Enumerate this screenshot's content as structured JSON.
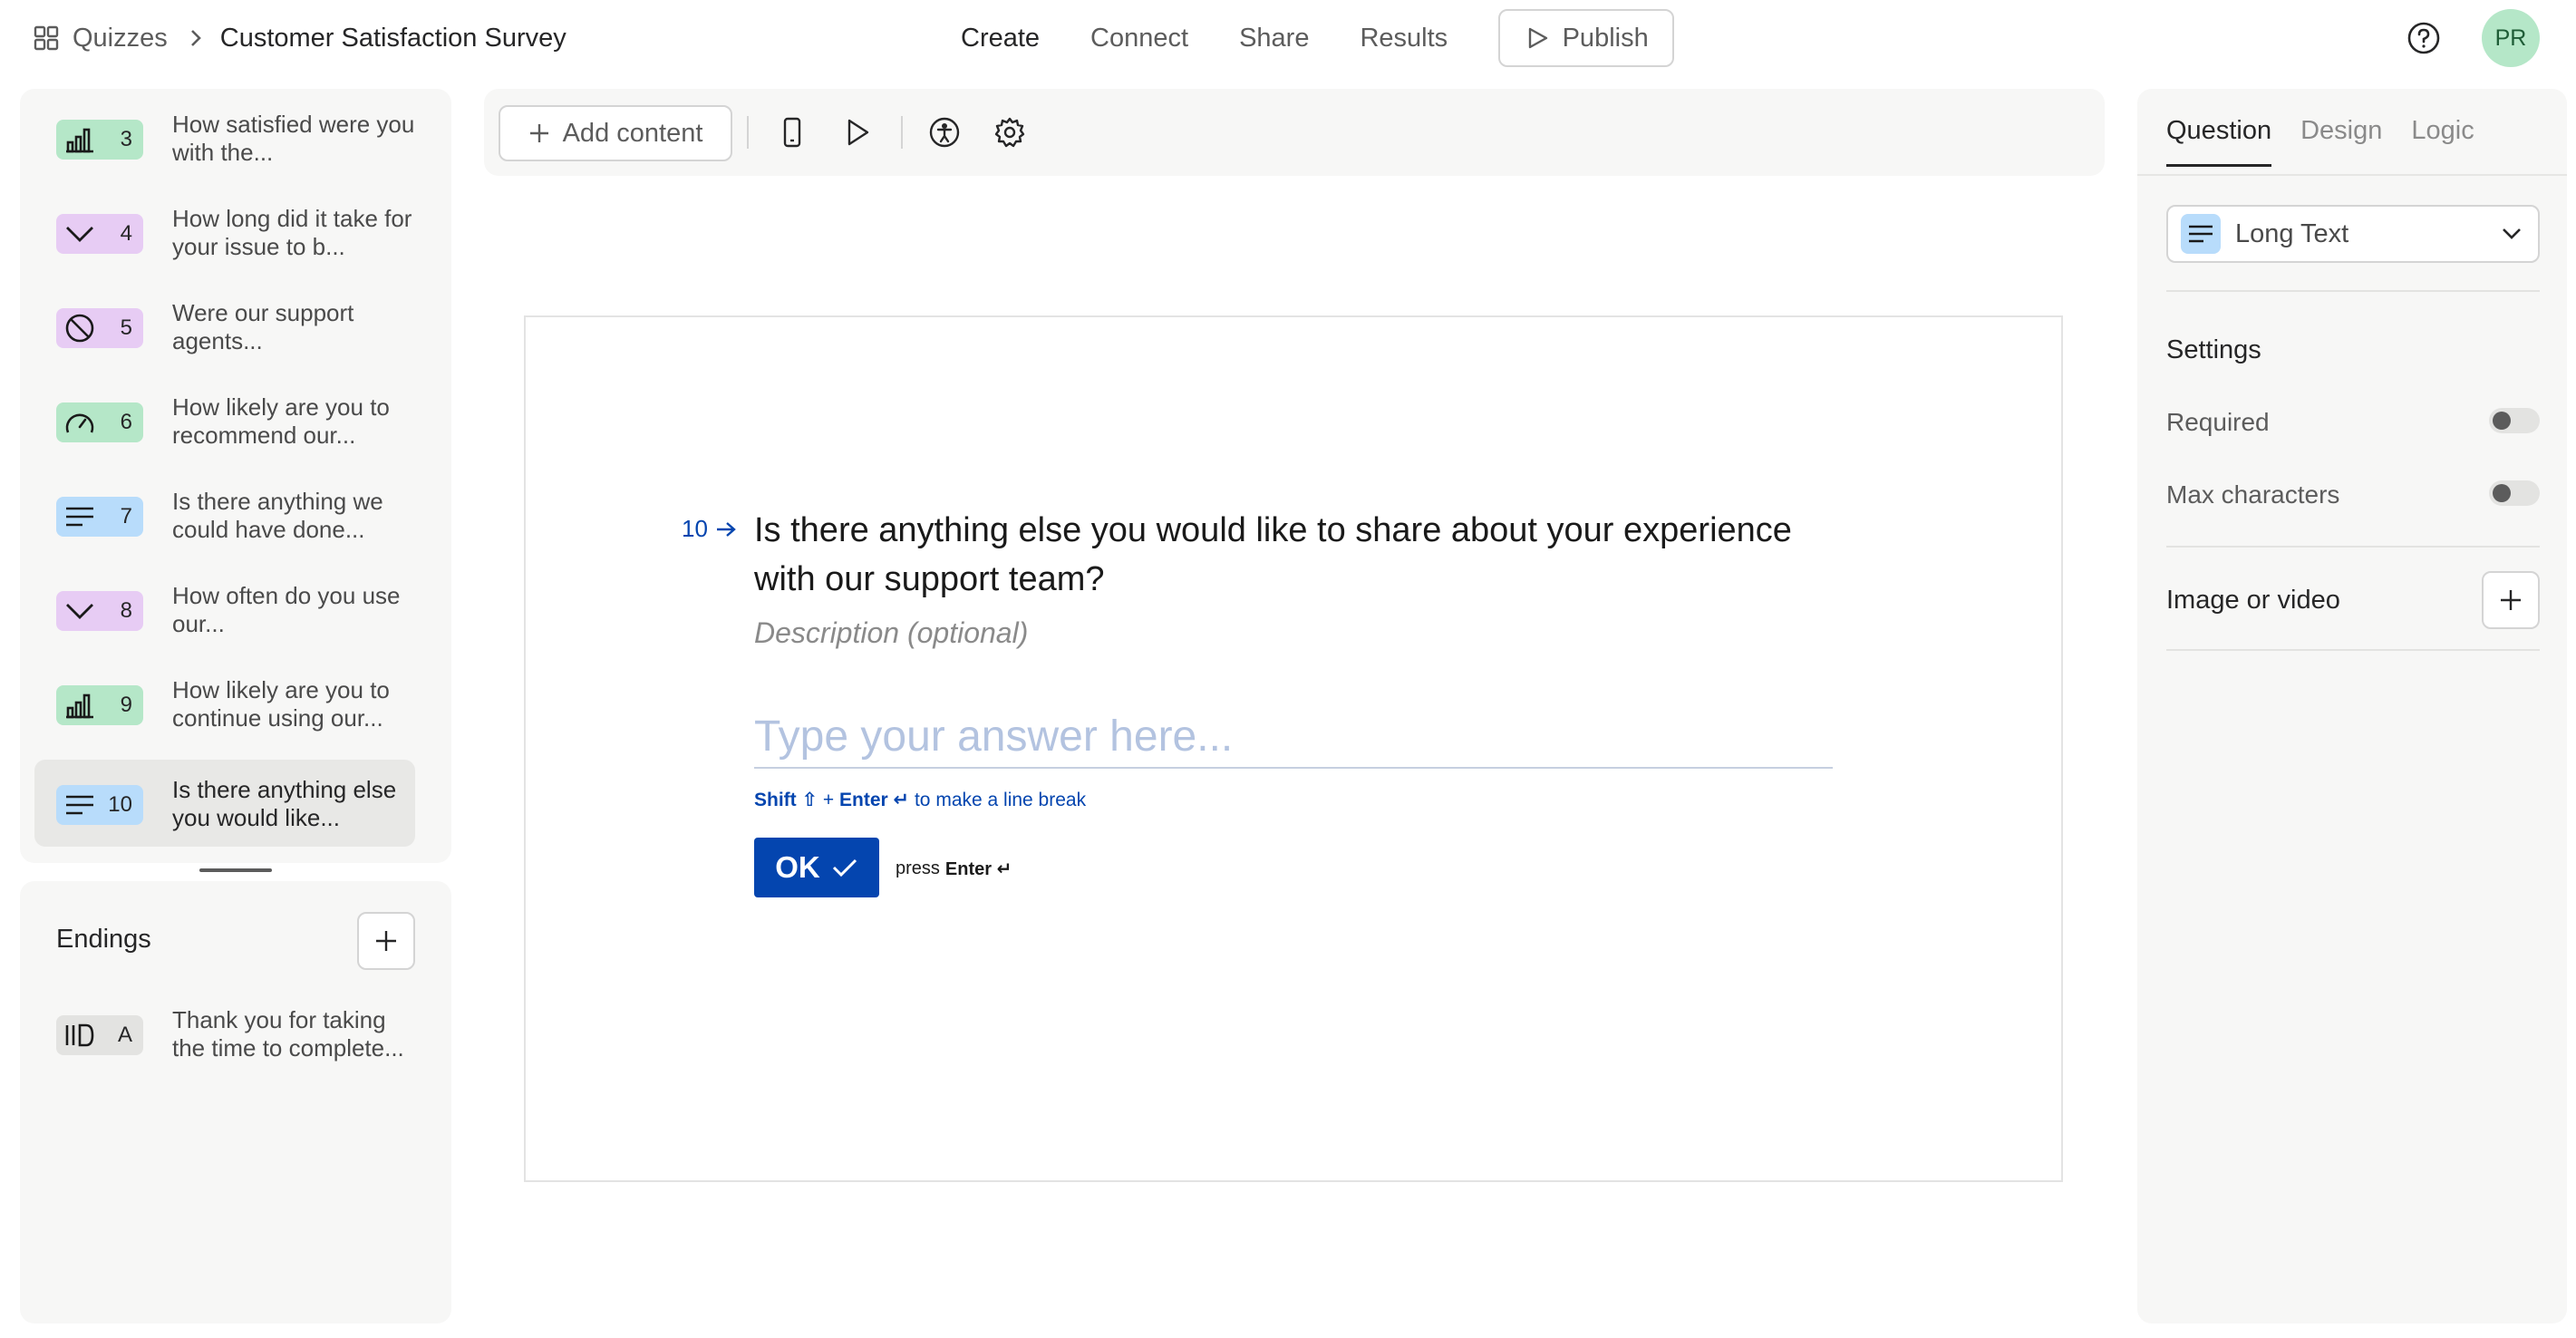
{
  "header": {
    "app_name": "Quizzes",
    "breadcrumb_sep": ">",
    "form_title": "Customer Satisfaction Survey",
    "nav": [
      "Create",
      "Connect",
      "Share",
      "Results"
    ],
    "publish_label": "Publish",
    "avatar_initials": "PR"
  },
  "questions": [
    {
      "num": "3",
      "text": "How satisfied were you with the...",
      "icon": "bar-chart-icon",
      "color": "green"
    },
    {
      "num": "4",
      "text": "How long did it take for your issue to b...",
      "icon": "chevron-down-icon",
      "color": "purple"
    },
    {
      "num": "5",
      "text": "Were our support agents...",
      "icon": "ban-icon",
      "color": "purple"
    },
    {
      "num": "6",
      "text": "How likely are you to recommend our...",
      "icon": "gauge-icon",
      "color": "green"
    },
    {
      "num": "7",
      "text": "Is there anything we could have done...",
      "icon": "long-text-icon",
      "color": "blue"
    },
    {
      "num": "8",
      "text": "How often do you use our...",
      "icon": "chevron-down-icon",
      "color": "purple"
    },
    {
      "num": "9",
      "text": "How likely are you to continue using our...",
      "icon": "bar-chart-icon",
      "color": "green"
    },
    {
      "num": "10",
      "text": "Is there anything else you would like...",
      "icon": "long-text-icon",
      "color": "blue",
      "selected": true
    }
  ],
  "endings": {
    "title": "Endings",
    "items": [
      {
        "letter": "A",
        "text": "Thank you for taking the time to complete...",
        "icon": "ending-icon"
      }
    ]
  },
  "toolbar": {
    "add_content_label": "Add content"
  },
  "question": {
    "number": "10",
    "title": "Is there anything else you would like to share about your experience with our support team?",
    "description_placeholder": "Description (optional)",
    "answer_placeholder": "Type your answer here...",
    "hint_shift": "Shift ⇧",
    "hint_plus": " + ",
    "hint_enter": "Enter ↵",
    "hint_rest": " to make a line break",
    "ok_label": "OK",
    "press_label": "press",
    "press_key": "Enter ↵"
  },
  "right_panel": {
    "tabs": [
      "Question",
      "Design",
      "Logic"
    ],
    "active_tab": "Question",
    "question_type": "Long Text",
    "settings_title": "Settings",
    "required_label": "Required",
    "required_on": false,
    "max_chars_label": "Max characters",
    "max_chars_on": false,
    "media_label": "Image or video"
  },
  "colors": {
    "accent": "#0445af",
    "green_badge": "#b5e7c8",
    "purple_badge": "#e7ccf4",
    "blue_badge": "#b8dcfb"
  }
}
